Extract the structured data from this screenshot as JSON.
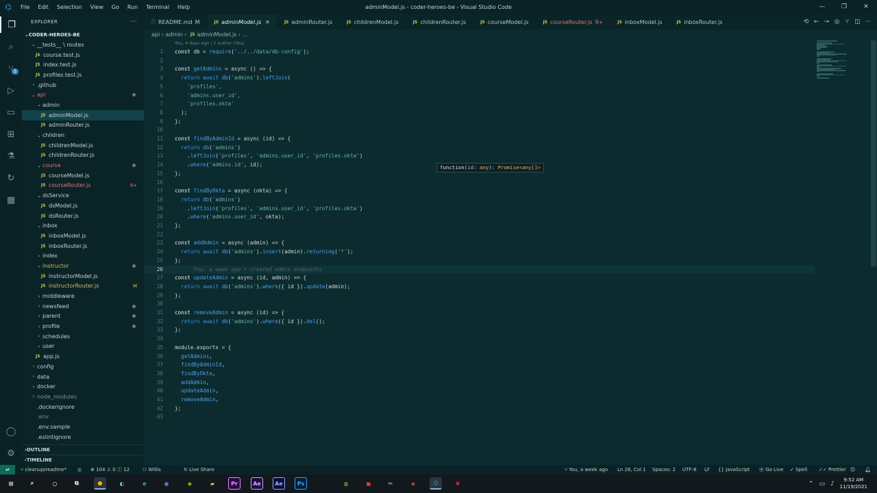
{
  "window": {
    "title": "adminModel.js - coder-heroes-be - Visual Studio Code",
    "menu": [
      "File",
      "Edit",
      "Selection",
      "View",
      "Go",
      "Run",
      "Terminal",
      "Help"
    ]
  },
  "activity_bar": {
    "scm_badge": "5"
  },
  "explorer": {
    "heading": "EXPLORER",
    "project": "CODER-HEROES-BE",
    "tree": [
      {
        "label": "__tests__ \\ routes",
        "indent": 1,
        "kind": "folder-open"
      },
      {
        "label": "course.test.js",
        "indent": 2,
        "kind": "js"
      },
      {
        "label": "index.test.js",
        "indent": 2,
        "kind": "js"
      },
      {
        "label": "profiles.test.js",
        "indent": 2,
        "kind": "js"
      },
      {
        "label": ".github",
        "indent": 1,
        "kind": "folder"
      },
      {
        "label": "api",
        "indent": 1,
        "kind": "folder-open",
        "color": "red",
        "dot": true
      },
      {
        "label": "admin",
        "indent": 2,
        "kind": "folder-open"
      },
      {
        "label": "adminModel.js",
        "indent": 3,
        "kind": "js",
        "selected": true
      },
      {
        "label": "adminRouter.js",
        "indent": 3,
        "kind": "js"
      },
      {
        "label": "children",
        "indent": 2,
        "kind": "folder-open"
      },
      {
        "label": "childrenModel.js",
        "indent": 3,
        "kind": "js"
      },
      {
        "label": "childrenRouter.js",
        "indent": 3,
        "kind": "js"
      },
      {
        "label": "course",
        "indent": 2,
        "kind": "folder-open",
        "color": "red",
        "dot": true
      },
      {
        "label": "courseModel.js",
        "indent": 3,
        "kind": "js"
      },
      {
        "label": "courseRouter.js",
        "indent": 3,
        "kind": "js",
        "color": "red",
        "mark": "9+"
      },
      {
        "label": "dsService",
        "indent": 2,
        "kind": "folder-open"
      },
      {
        "label": "dsModel.js",
        "indent": 3,
        "kind": "js"
      },
      {
        "label": "dsRouter.js",
        "indent": 3,
        "kind": "js"
      },
      {
        "label": "inbox",
        "indent": 2,
        "kind": "folder-open"
      },
      {
        "label": "inboxModel.js",
        "indent": 3,
        "kind": "js"
      },
      {
        "label": "inboxRouter.js",
        "indent": 3,
        "kind": "js"
      },
      {
        "label": "index",
        "indent": 2,
        "kind": "folder"
      },
      {
        "label": "instructor",
        "indent": 2,
        "kind": "folder-open",
        "color": "yel",
        "dot": true
      },
      {
        "label": "instructorModel.js",
        "indent": 3,
        "kind": "js"
      },
      {
        "label": "instructorRouter.js",
        "indent": 3,
        "kind": "js",
        "color": "yel",
        "mark": "M"
      },
      {
        "label": "middleware",
        "indent": 2,
        "kind": "folder"
      },
      {
        "label": "newsfeed",
        "indent": 2,
        "kind": "folder",
        "dot": true
      },
      {
        "label": "parent",
        "indent": 2,
        "kind": "folder",
        "dot": true
      },
      {
        "label": "profile",
        "indent": 2,
        "kind": "folder",
        "dot": true
      },
      {
        "label": "schedules",
        "indent": 2,
        "kind": "folder"
      },
      {
        "label": "user",
        "indent": 2,
        "kind": "folder"
      },
      {
        "label": "app.js",
        "indent": 2,
        "kind": "js"
      },
      {
        "label": "config",
        "indent": 1,
        "kind": "folder"
      },
      {
        "label": "data",
        "indent": 1,
        "kind": "folder"
      },
      {
        "label": "docker",
        "indent": 1,
        "kind": "folder"
      },
      {
        "label": "node_modules",
        "indent": 1,
        "kind": "folder",
        "color": "dim"
      },
      {
        "label": ".dockerignore",
        "indent": 1,
        "kind": "file"
      },
      {
        "label": ".env",
        "indent": 1,
        "kind": "file",
        "color": "dim"
      },
      {
        "label": ".env.sample",
        "indent": 1,
        "kind": "file"
      },
      {
        "label": ".eslintignore",
        "indent": 1,
        "kind": "file"
      }
    ],
    "outline": "OUTLINE",
    "timeline": "TIMELINE"
  },
  "tabs": [
    {
      "label": "README.md",
      "suffix": "M",
      "icon": "md",
      "active": false
    },
    {
      "label": "adminModel.js",
      "icon": "js",
      "active": true
    },
    {
      "label": "adminRouter.js",
      "icon": "js",
      "active": false
    },
    {
      "label": "childrenModel.js",
      "icon": "js",
      "active": false
    },
    {
      "label": "childrenRouter.js",
      "icon": "js",
      "active": false
    },
    {
      "label": "courseModel.js",
      "icon": "js",
      "active": false
    },
    {
      "label": "courseRouter.js",
      "suffix": "9+",
      "icon": "js",
      "active": false,
      "color": "red"
    },
    {
      "label": "inboxModel.js",
      "icon": "js",
      "active": false
    },
    {
      "label": "inboxRouter.js",
      "icon": "js",
      "active": false
    }
  ],
  "breadcrumb": {
    "parts": [
      "api",
      "admin",
      "adminModel.js",
      "..."
    ]
  },
  "editor": {
    "blame": "You, 4 days ago | 1 author (You)",
    "hover": {
      "prefix": "function(",
      "param": "id",
      "colon": ": ",
      "ptype": "any",
      "mid": "): ",
      "ret": "Promise<any[]>"
    },
    "current_line": 26,
    "lines": [
      [
        [
          "k",
          "const "
        ],
        [
          "p",
          "db = "
        ],
        [
          "f",
          "require"
        ],
        [
          "p",
          "("
        ],
        [
          "s",
          "'../../data/db-config'"
        ],
        [
          "p",
          ");"
        ]
      ],
      [],
      [
        [
          "k",
          "const "
        ],
        [
          "f",
          "getAdmins"
        ],
        [
          "p",
          " = async () => {"
        ]
      ],
      [
        [
          "p",
          "  "
        ],
        [
          "m",
          "return await "
        ],
        [
          "f",
          "db"
        ],
        [
          "p",
          "("
        ],
        [
          "s",
          "'admins'"
        ],
        [
          "p",
          ")."
        ],
        [
          "f",
          "leftJoin"
        ],
        [
          "p",
          "("
        ]
      ],
      [
        [
          "s",
          "    'profiles',"
        ]
      ],
      [
        [
          "s",
          "    'admins.user_id',"
        ]
      ],
      [
        [
          "s",
          "    'profiles.okta'"
        ]
      ],
      [
        [
          "p",
          "  );"
        ]
      ],
      [
        [
          "p",
          "};"
        ]
      ],
      [],
      [
        [
          "k",
          "const "
        ],
        [
          "f",
          "findByAdminId"
        ],
        [
          "p",
          " = async (id) => {"
        ]
      ],
      [
        [
          "p",
          "  "
        ],
        [
          "m",
          "return "
        ],
        [
          "f",
          "db"
        ],
        [
          "p",
          "("
        ],
        [
          "s",
          "'admins'"
        ],
        [
          "p",
          ")"
        ]
      ],
      [
        [
          "p",
          "    ."
        ],
        [
          "f",
          "leftJoin"
        ],
        [
          "p",
          "("
        ],
        [
          "s",
          "'profiles'"
        ],
        [
          "p",
          ", "
        ],
        [
          "s",
          "'admins.user_id'"
        ],
        [
          "p",
          ", "
        ],
        [
          "s",
          "'profiles.okta'"
        ],
        [
          "p",
          ")"
        ]
      ],
      [
        [
          "p",
          "    ."
        ],
        [
          "f",
          "where"
        ],
        [
          "p",
          "("
        ],
        [
          "s",
          "'admins.id'"
        ],
        [
          "p",
          ", id);"
        ]
      ],
      [
        [
          "p",
          "};"
        ]
      ],
      [],
      [
        [
          "k",
          "const "
        ],
        [
          "f",
          "findByOkta"
        ],
        [
          "p",
          " = async (okta) => {"
        ]
      ],
      [
        [
          "p",
          "  "
        ],
        [
          "m",
          "return "
        ],
        [
          "f",
          "db"
        ],
        [
          "p",
          "("
        ],
        [
          "s",
          "'admins'"
        ],
        [
          "p",
          ")"
        ]
      ],
      [
        [
          "p",
          "    ."
        ],
        [
          "f",
          "leftJoin"
        ],
        [
          "p",
          "("
        ],
        [
          "s",
          "'profiles'"
        ],
        [
          "p",
          ", "
        ],
        [
          "s",
          "'admins.user_id'"
        ],
        [
          "p",
          ", "
        ],
        [
          "s",
          "'profiles.okta'"
        ],
        [
          "p",
          ")"
        ]
      ],
      [
        [
          "p",
          "    ."
        ],
        [
          "f",
          "where"
        ],
        [
          "p",
          "("
        ],
        [
          "s",
          "'admins.user_id'"
        ],
        [
          "p",
          ", okta);"
        ]
      ],
      [
        [
          "p",
          "};"
        ]
      ],
      [],
      [
        [
          "k",
          "const "
        ],
        [
          "f",
          "addAdmin"
        ],
        [
          "p",
          " = async (admin) => {"
        ]
      ],
      [
        [
          "p",
          "  "
        ],
        [
          "m",
          "return await "
        ],
        [
          "f",
          "db"
        ],
        [
          "p",
          "("
        ],
        [
          "s",
          "'admins'"
        ],
        [
          "p",
          ")."
        ],
        [
          "f",
          "insert"
        ],
        [
          "p",
          "(admin)."
        ],
        [
          "f",
          "returning"
        ],
        [
          "p",
          "("
        ],
        [
          "s",
          "'*'"
        ],
        [
          "p",
          ");"
        ]
      ],
      [
        [
          "p",
          "};"
        ]
      ],
      [
        [
          "g",
          "      You, a week ago • created admin endpoints"
        ]
      ],
      [
        [
          "k",
          "const "
        ],
        [
          "f",
          "updateAdmin"
        ],
        [
          "p",
          " = async (id, admin) => {"
        ]
      ],
      [
        [
          "p",
          "  "
        ],
        [
          "m",
          "return await "
        ],
        [
          "f",
          "db"
        ],
        [
          "p",
          "("
        ],
        [
          "s",
          "'admins'"
        ],
        [
          "p",
          ")."
        ],
        [
          "f",
          "where"
        ],
        [
          "p",
          "({ id })."
        ],
        [
          "f",
          "update"
        ],
        [
          "p",
          "(admin);"
        ]
      ],
      [
        [
          "p",
          "};"
        ]
      ],
      [],
      [
        [
          "k",
          "const "
        ],
        [
          "f",
          "removeAdmin"
        ],
        [
          "p",
          " = async (id) => {"
        ]
      ],
      [
        [
          "p",
          "  "
        ],
        [
          "m",
          "return await "
        ],
        [
          "f",
          "db"
        ],
        [
          "p",
          "("
        ],
        [
          "s",
          "'admins'"
        ],
        [
          "p",
          ")."
        ],
        [
          "f",
          "where"
        ],
        [
          "p",
          "({ id })."
        ],
        [
          "f",
          "del"
        ],
        [
          "p",
          "();"
        ]
      ],
      [
        [
          "p",
          "};"
        ]
      ],
      [],
      [
        [
          "p",
          "module.exports = {"
        ]
      ],
      [
        [
          "f",
          "  getAdmins"
        ],
        [
          "p",
          ","
        ]
      ],
      [
        [
          "f",
          "  findByAdminId"
        ],
        [
          "p",
          ","
        ]
      ],
      [
        [
          "f",
          "  findByOkta"
        ],
        [
          "p",
          ","
        ]
      ],
      [
        [
          "f",
          "  addAdmin"
        ],
        [
          "p",
          ","
        ]
      ],
      [
        [
          "f",
          "  updateAdmin"
        ],
        [
          "p",
          ","
        ]
      ],
      [
        [
          "f",
          "  removeAdmin"
        ],
        [
          "p",
          ","
        ]
      ],
      [
        [
          "p",
          "};"
        ]
      ],
      []
    ]
  },
  "status": {
    "branch": "cleanup/readme*",
    "problems_errors": "104",
    "problems_warnings": "0",
    "problems_info": "12",
    "user": "Willis",
    "live_share": "Live Share",
    "blame": "You, a week ago",
    "position": "Ln 26, Col 1",
    "spaces": "Spaces: 2",
    "encoding": "UTF-8",
    "eol": "LF",
    "language": "JavaScript",
    "go_live": "Go Live",
    "spell": "Spell",
    "prettier": "Prettier"
  },
  "taskbar": {
    "time": "9:52 AM",
    "date": "11/19/2021",
    "apps": [
      {
        "name": "start",
        "glyph": "⊞",
        "color": "#ffffff"
      },
      {
        "name": "search",
        "glyph": "⌕",
        "color": "#ffffff"
      },
      {
        "name": "cortana",
        "glyph": "○",
        "color": "#ffffff"
      },
      {
        "name": "task-view",
        "glyph": "⧉",
        "color": "#ffffff"
      },
      {
        "name": "chrome",
        "glyph": "●",
        "color": "#f4b400",
        "active": true
      },
      {
        "name": "steam",
        "glyph": "◐",
        "color": "#66c0f4"
      },
      {
        "name": "edge",
        "glyph": "e",
        "color": "#2eb3e8"
      },
      {
        "name": "discord",
        "glyph": "◉",
        "color": "#7289da"
      },
      {
        "name": "nvidia",
        "glyph": "◆",
        "color": "#76b900"
      },
      {
        "name": "file-explorer",
        "glyph": "▰",
        "color": "#f0c040"
      },
      {
        "name": "premiere",
        "glyph": "Pr",
        "color": "#e392ff",
        "bg": "#2a0a45"
      },
      {
        "name": "after-effects",
        "glyph": "Ae",
        "color": "#d7a3ff",
        "bg": "#1e0d40"
      },
      {
        "name": "after-effects-2",
        "glyph": "Ae",
        "color": "#9ba7ff",
        "bg": "#0a0f3a"
      },
      {
        "name": "photoshop",
        "glyph": "Ps",
        "color": "#31a8ff",
        "bg": "#051c33"
      },
      {
        "name": "xbox",
        "glyph": "◍",
        "color": "#7ccc3c"
      },
      {
        "name": "game",
        "glyph": "▣",
        "color": "#ff4040"
      },
      {
        "name": "snip",
        "glyph": "✂",
        "color": "#cfd8dc"
      },
      {
        "name": "git",
        "glyph": "◈",
        "color": "#f05133"
      },
      {
        "name": "vscode",
        "glyph": "⌬",
        "color": "#3aa0e8",
        "active": true
      },
      {
        "name": "slack",
        "glyph": "✱",
        "color": "#e01e5a"
      }
    ]
  }
}
